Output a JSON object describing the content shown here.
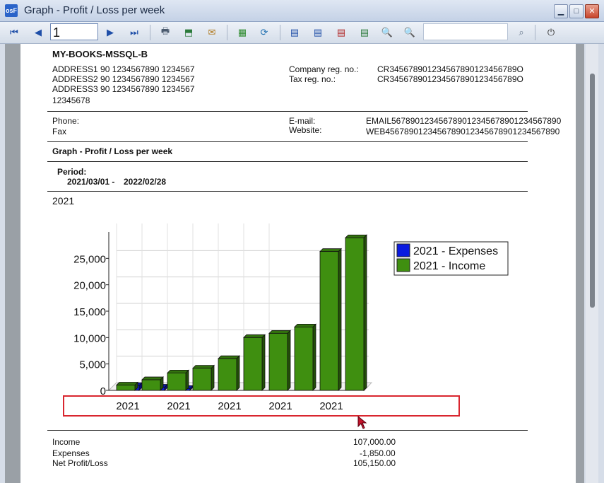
{
  "window": {
    "title": "Graph - Profit / Loss per week",
    "app_icon": "osf-logo-icon"
  },
  "toolbar": {
    "page_value": "1",
    "search_placeholder": ""
  },
  "company": {
    "name": "MY-BOOKS-MSSQL-B",
    "address1": "ADDRESS1 90 1234567890 1234567",
    "address2": "ADDRESS2 90 1234567890 1234567",
    "address3": "ADDRESS3 90 1234567890 1234567",
    "zip": "12345678",
    "reg_label": "Company reg. no.:",
    "reg_value": "CR345678901234567890123456789O",
    "tax_label": "Tax reg. no.:",
    "tax_value": "CR345678901234567890123456789O",
    "phone_label": "Phone:",
    "fax_label": "Fax",
    "email_label": "E-mail:",
    "email_value": "EMAIL567890123456789012345678901234567890",
    "website_label": "Website:",
    "website_value": "WEB4567890123456789012345678901234567890"
  },
  "report": {
    "title": "Graph - Profit / Loss per week",
    "period_label": "Period:",
    "period_from": "2021/03/01 -",
    "period_to": "2022/02/28",
    "year_heading": "2021"
  },
  "chart_data": {
    "type": "bar",
    "categories": [
      "2021",
      "",
      "2021",
      "",
      "2021",
      "",
      "2021",
      "",
      "2021",
      ""
    ],
    "series": [
      {
        "name": "2021 - Expenses",
        "color": "#0a1ae0",
        "values": [
          -900,
          -600,
          -350,
          0,
          0,
          0,
          0,
          0,
          0,
          0
        ]
      },
      {
        "name": "2021 - Income",
        "color": "#3f8f10",
        "values": [
          1000,
          2000,
          3300,
          4200,
          6000,
          10000,
          10800,
          12000,
          26300,
          28900
        ]
      }
    ],
    "ylim": [
      0,
      30000
    ],
    "yticks": [
      "0",
      "5,000",
      "10,000",
      "15,000",
      "20,000",
      "25,000"
    ],
    "ytick_values": [
      0,
      5000,
      10000,
      15000,
      20000,
      25000
    ],
    "grid": true,
    "legend": "top-right"
  },
  "summary": {
    "income_label": "Income",
    "income_value": "107,000.00",
    "expenses_label": "Expenses",
    "expenses_value": "-1,850.00",
    "net_label": "Net Profit/Loss",
    "net_value": "105,150.00"
  }
}
